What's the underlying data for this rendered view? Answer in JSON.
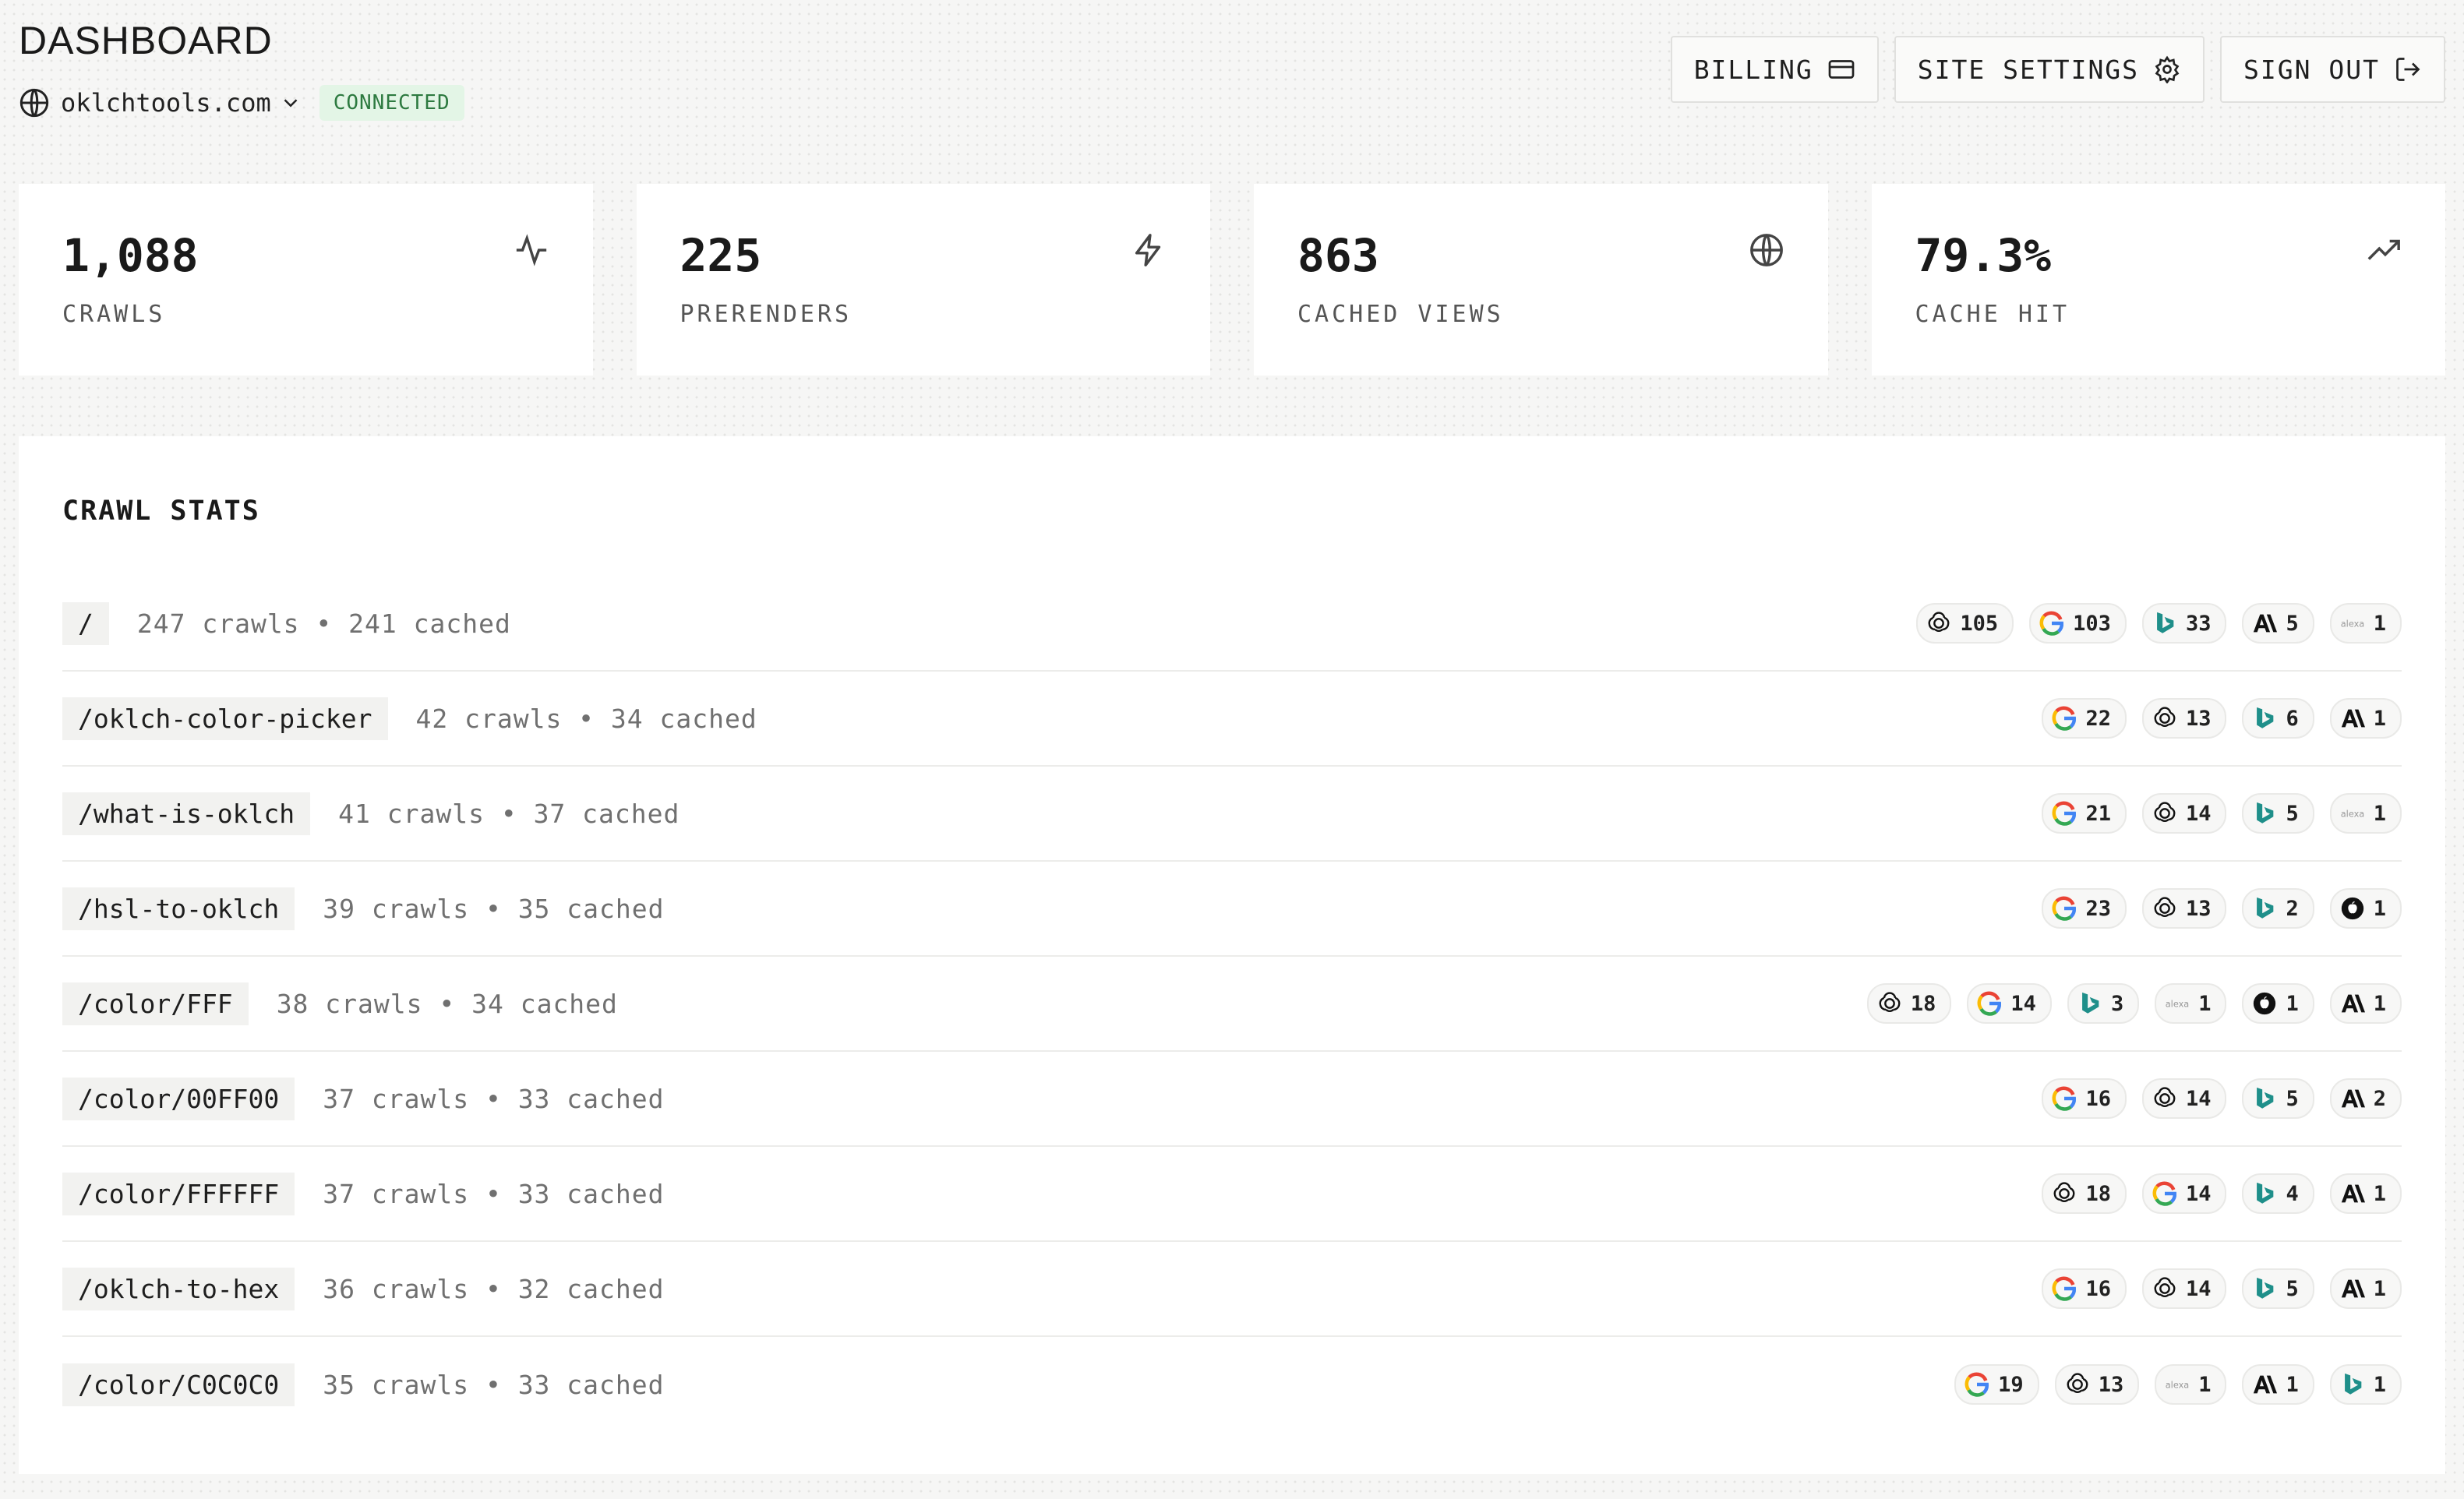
{
  "header": {
    "title": "DASHBOARD",
    "site": "oklchtools.com",
    "status": "CONNECTED",
    "buttons": {
      "billing": "BILLING",
      "settings": "SITE SETTINGS",
      "signout": "SIGN OUT"
    }
  },
  "stats": [
    {
      "value": "1,088",
      "label": "CRAWLS",
      "icon": "activity-icon"
    },
    {
      "value": "225",
      "label": "PRERENDERS",
      "icon": "zap-icon"
    },
    {
      "value": "863",
      "label": "CACHED VIEWS",
      "icon": "globe-icon"
    },
    {
      "value": "79.3%",
      "label": "CACHE HIT",
      "icon": "trending-up-icon"
    }
  ],
  "crawl_stats": {
    "title": "CRAWL STATS",
    "rows": [
      {
        "path": "/",
        "meta": "247 crawls • 241 cached",
        "bots": [
          [
            "openai",
            "105"
          ],
          [
            "google",
            "103"
          ],
          [
            "bing",
            "33"
          ],
          [
            "anthropic",
            "5"
          ],
          [
            "alexa",
            "1"
          ]
        ]
      },
      {
        "path": "/oklch-color-picker",
        "meta": "42 crawls • 34 cached",
        "bots": [
          [
            "google",
            "22"
          ],
          [
            "openai",
            "13"
          ],
          [
            "bing",
            "6"
          ],
          [
            "anthropic",
            "1"
          ]
        ]
      },
      {
        "path": "/what-is-oklch",
        "meta": "41 crawls • 37 cached",
        "bots": [
          [
            "google",
            "21"
          ],
          [
            "openai",
            "14"
          ],
          [
            "bing",
            "5"
          ],
          [
            "alexa",
            "1"
          ]
        ]
      },
      {
        "path": "/hsl-to-oklch",
        "meta": "39 crawls • 35 cached",
        "bots": [
          [
            "google",
            "23"
          ],
          [
            "openai",
            "13"
          ],
          [
            "bing",
            "2"
          ],
          [
            "apple",
            "1"
          ]
        ]
      },
      {
        "path": "/color/FFF",
        "meta": "38 crawls • 34 cached",
        "bots": [
          [
            "openai",
            "18"
          ],
          [
            "google",
            "14"
          ],
          [
            "bing",
            "3"
          ],
          [
            "alexa",
            "1"
          ],
          [
            "apple",
            "1"
          ],
          [
            "anthropic",
            "1"
          ]
        ]
      },
      {
        "path": "/color/00FF00",
        "meta": "37 crawls • 33 cached",
        "bots": [
          [
            "google",
            "16"
          ],
          [
            "openai",
            "14"
          ],
          [
            "bing",
            "5"
          ],
          [
            "anthropic",
            "2"
          ]
        ]
      },
      {
        "path": "/color/FFFFFF",
        "meta": "37 crawls • 33 cached",
        "bots": [
          [
            "openai",
            "18"
          ],
          [
            "google",
            "14"
          ],
          [
            "bing",
            "4"
          ],
          [
            "anthropic",
            "1"
          ]
        ]
      },
      {
        "path": "/oklch-to-hex",
        "meta": "36 crawls • 32 cached",
        "bots": [
          [
            "google",
            "16"
          ],
          [
            "openai",
            "14"
          ],
          [
            "bing",
            "5"
          ],
          [
            "anthropic",
            "1"
          ]
        ]
      },
      {
        "path": "/color/C0C0C0",
        "meta": "35 crawls • 33 cached",
        "bots": [
          [
            "google",
            "19"
          ],
          [
            "openai",
            "13"
          ],
          [
            "alexa",
            "1"
          ],
          [
            "anthropic",
            "1"
          ],
          [
            "bing",
            "1"
          ]
        ]
      }
    ]
  },
  "colors": {
    "accent_green": "#2d7a40",
    "connected_bg": "#e3f5e6",
    "bing": "#1f8f8a"
  }
}
